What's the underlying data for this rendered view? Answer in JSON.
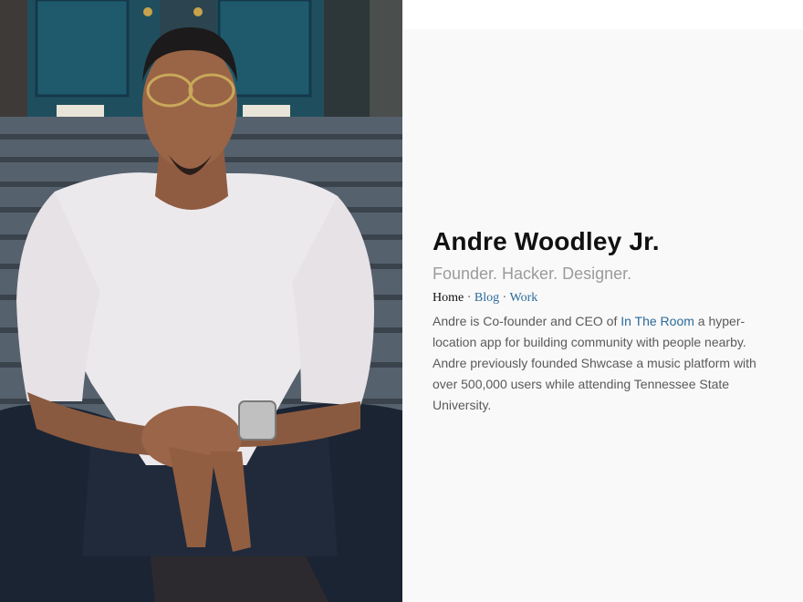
{
  "profile": {
    "name": "Andre Woodley Jr.",
    "tagline": "Founder. Hacker. Designer."
  },
  "nav": {
    "home": "Home",
    "blog": "Blog",
    "work": "Work",
    "separator": "·"
  },
  "bio": {
    "part1": "Andre is Co-founder and CEO of",
    "company_link": "In The Room",
    "part2": "a hyper-location app for building community with people nearby. Andre previously founded Shwcase a music platform with over 500,000 users while attending Tennessee State University."
  },
  "colors": {
    "link": "#2b6a9a",
    "name": "#111111",
    "tagline": "#9b9b9b",
    "body_text": "#5a5a5a",
    "panel_background": "#f9f9f9"
  }
}
